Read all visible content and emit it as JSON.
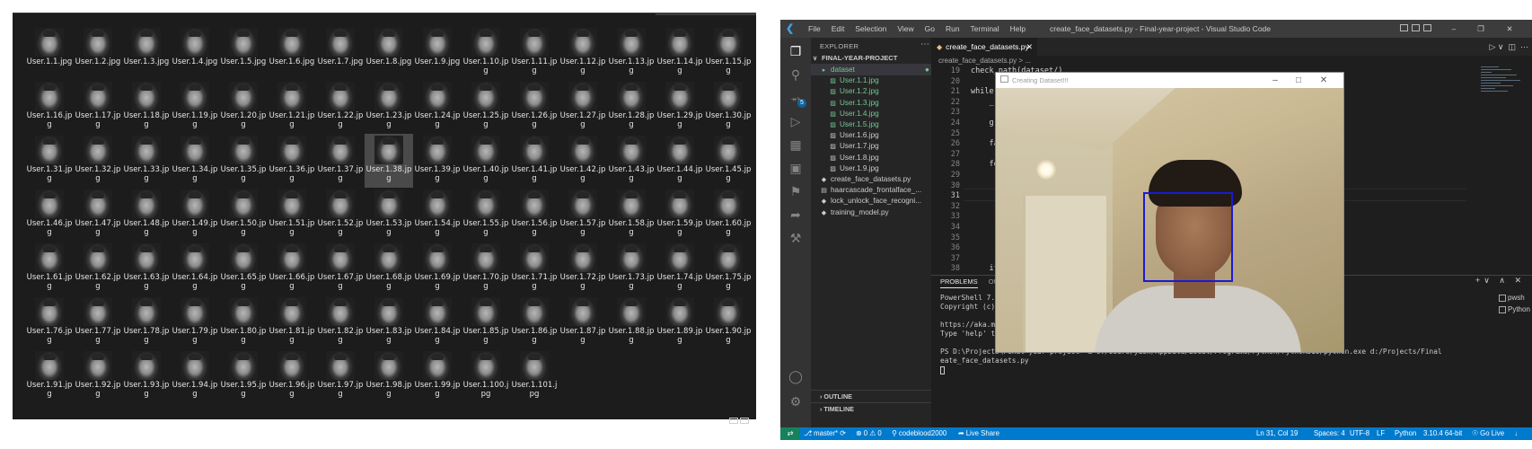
{
  "explorer": {
    "files": [
      "User.1.1.jpg",
      "User.1.2.jpg",
      "User.1.3.jpg",
      "User.1.4.jpg",
      "User.1.5.jpg",
      "User.1.6.jpg",
      "User.1.7.jpg",
      "User.1.8.jpg",
      "User.1.9.jpg",
      "User.1.10.jpg",
      "User.1.11.jpg",
      "User.1.12.jpg",
      "User.1.13.jpg",
      "User.1.14.jpg",
      "User.1.15.jpg",
      "User.1.16.jpg",
      "User.1.17.jpg",
      "User.1.18.jpg",
      "User.1.19.jpg",
      "User.1.20.jpg",
      "User.1.21.jpg",
      "User.1.22.jpg",
      "User.1.23.jpg",
      "User.1.24.jpg",
      "User.1.25.jpg",
      "User.1.26.jpg",
      "User.1.27.jpg",
      "User.1.28.jpg",
      "User.1.29.jpg",
      "User.1.30.jpg",
      "User.1.31.jpg",
      "User.1.32.jpg",
      "User.1.33.jpg",
      "User.1.34.jpg",
      "User.1.35.jpg",
      "User.1.36.jpg",
      "User.1.37.jpg",
      "User.1.38.jpg",
      "User.1.39.jpg",
      "User.1.40.jpg",
      "User.1.41.jpg",
      "User.1.42.jpg",
      "User.1.43.jpg",
      "User.1.44.jpg",
      "User.1.45.jpg",
      "User.1.46.jpg",
      "User.1.47.jpg",
      "User.1.48.jpg",
      "User.1.49.jpg",
      "User.1.50.jpg",
      "User.1.51.jpg",
      "User.1.52.jpg",
      "User.1.53.jpg",
      "User.1.54.jpg",
      "User.1.55.jpg",
      "User.1.56.jpg",
      "User.1.57.jpg",
      "User.1.58.jpg",
      "User.1.59.jpg",
      "User.1.60.jpg",
      "User.1.61.jpg",
      "User.1.62.jpg",
      "User.1.63.jpg",
      "User.1.64.jpg",
      "User.1.65.jpg",
      "User.1.66.jpg",
      "User.1.67.jpg",
      "User.1.68.jpg",
      "User.1.69.jpg",
      "User.1.70.jpg",
      "User.1.71.jpg",
      "User.1.72.jpg",
      "User.1.73.jpg",
      "User.1.74.jpg",
      "User.1.75.jpg",
      "User.1.76.jpg",
      "User.1.77.jpg",
      "User.1.78.jpg",
      "User.1.79.jpg",
      "User.1.80.jpg",
      "User.1.81.jpg",
      "User.1.82.jpg",
      "User.1.83.jpg",
      "User.1.84.jpg",
      "User.1.85.jpg",
      "User.1.86.jpg",
      "User.1.87.jpg",
      "User.1.88.jpg",
      "User.1.89.jpg",
      "User.1.90.jpg",
      "User.1.91.jpg",
      "User.1.92.jpg",
      "User.1.93.jpg",
      "User.1.94.jpg",
      "User.1.95.jpg",
      "User.1.96.jpg",
      "User.1.97.jpg",
      "User.1.98.jpg",
      "User.1.99.jpg",
      "User.1.100.jpg",
      "User.1.101.jpg"
    ],
    "selected": "User.1.38.jpg"
  },
  "vscode": {
    "title": "create_face_datasets.py - Final-year-project - Visual Studio Code",
    "menu": [
      "File",
      "Edit",
      "Selection",
      "View",
      "Go",
      "Run",
      "Terminal",
      "Help"
    ],
    "explorer_label": "EXPLORER",
    "project": "FINAL-YEAR-PROJECT",
    "tree": [
      {
        "label": "dataset",
        "kind": "folder",
        "flag": "●",
        "green": true
      },
      {
        "label": "User.1.1.jpg",
        "kind": "img",
        "flag": "U",
        "green": true
      },
      {
        "label": "User.1.2.jpg",
        "kind": "img",
        "flag": "U",
        "green": true
      },
      {
        "label": "User.1.3.jpg",
        "kind": "img",
        "flag": "U",
        "green": true
      },
      {
        "label": "User.1.4.jpg",
        "kind": "img",
        "flag": "U",
        "green": true
      },
      {
        "label": "User.1.5.jpg",
        "kind": "img",
        "flag": "U",
        "green": true
      },
      {
        "label": "User.1.6.jpg",
        "kind": "img",
        "flag": "",
        "green": false
      },
      {
        "label": "User.1.7.jpg",
        "kind": "img",
        "flag": "",
        "green": false
      },
      {
        "label": "User.1.8.jpg",
        "kind": "img",
        "flag": "",
        "green": false
      },
      {
        "label": "User.1.9.jpg",
        "kind": "img",
        "flag": "",
        "green": false
      },
      {
        "label": "create_face_datasets.py",
        "kind": "py",
        "flag": "",
        "green": false
      },
      {
        "label": "haarcascade_frontalface_...",
        "kind": "xml",
        "flag": "",
        "green": false
      },
      {
        "label": "lock_unlock_face_recogni...",
        "kind": "py",
        "flag": "",
        "green": false
      },
      {
        "label": "training_model.py",
        "kind": "py",
        "flag": "",
        "green": false
      }
    ],
    "tab": "create_face_datasets.py",
    "breadcrumb": "create_face_datasets.py > ...",
    "code": [
      {
        "n": "19",
        "t": "check_path(dataset/)"
      },
      {
        "n": "20",
        "t": ""
      },
      {
        "n": "21",
        "t": "while(Tr"
      },
      {
        "n": "22",
        "t": "    _, i"
      },
      {
        "n": "23",
        "t": ""
      },
      {
        "n": "24",
        "t": "    gray"
      },
      {
        "n": "25",
        "t": ""
      },
      {
        "n": "26",
        "t": "    face"
      },
      {
        "n": "27",
        "t": ""
      },
      {
        "n": "28",
        "t": "    for"
      },
      {
        "n": "29",
        "t": ""
      },
      {
        "n": "30",
        "t": ""
      },
      {
        "n": "31",
        "t": ""
      },
      {
        "n": "32",
        "t": ""
      },
      {
        "n": "33",
        "t": ""
      },
      {
        "n": "34",
        "t": ""
      },
      {
        "n": "35",
        "t": ""
      },
      {
        "n": "36",
        "t": ""
      },
      {
        "n": "37",
        "t": ""
      },
      {
        "n": "38",
        "t": "    if c"
      }
    ],
    "panel_tabs": [
      "PROBLEMS",
      "OUTPU"
    ],
    "terminal": [
      "PowerShell 7.2.",
      "Copyright (c) Mi",
      "",
      "https://aka.ms/p",
      "Type 'help' to g",
      "",
      "PS D:\\Projects\\Final-year-project> & C:/Users/yash/AppData/Local/Programs/Python/Python310/python.exe d:/Projects/Final-year-project/cr",
      "eate_face_datasets.py"
    ],
    "shells": [
      "pwsh",
      "Python"
    ],
    "outline": "OUTLINE",
    "timeline": "TIMELINE",
    "status": {
      "branch": "master*",
      "problems": "⊗ 0 ⚠ 0",
      "user": "codeblood2000",
      "liveshare": "Live Share",
      "position": "Ln 31, Col 19",
      "spaces": "Spaces: 4",
      "encoding": "UTF-8",
      "eol": "LF",
      "lang": "Python",
      "interpreter": "3.10.4 64-bit",
      "golive": "Go Live"
    }
  },
  "camera": {
    "title": "Creating Dataset!!!"
  }
}
